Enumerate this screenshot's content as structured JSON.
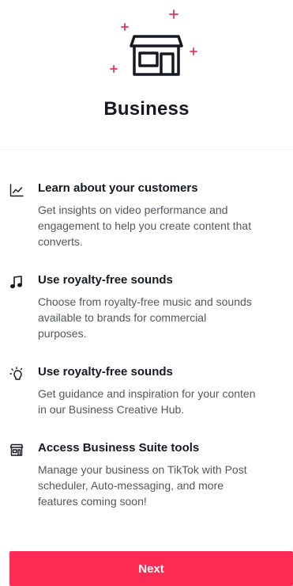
{
  "header": {
    "icon": "storefront-icon",
    "title": "Business"
  },
  "features": [
    {
      "icon": "analytics-chart-icon",
      "title": "Learn about your customers",
      "lines": [
        "Get insights on video performance and",
        "engagement to help you create content that",
        "converts."
      ]
    },
    {
      "icon": "music-note-icon",
      "title": "Use royalty-free sounds",
      "lines": [
        "Choose from royalty-free music and sounds",
        "available to brands for commercial",
        "purposes."
      ]
    },
    {
      "icon": "lightbulb-icon",
      "title": "Use royalty-free sounds",
      "lines": [
        "Get guidance and inspiration for your conten",
        "in our Business Creative Hub."
      ]
    },
    {
      "icon": "store-icon",
      "title": "Access Business Suite tools",
      "lines": [
        "Manage your business on TikTok with Post",
        "scheduler, Auto-messaging, and more",
        "features coming soon!"
      ]
    }
  ],
  "footer": {
    "next_label": "Next"
  },
  "colors": {
    "accent": "#fe2c55",
    "sparkle": "#e8335a",
    "title": "#161823",
    "body_text": "#545660",
    "icon_stroke": "#161823"
  }
}
